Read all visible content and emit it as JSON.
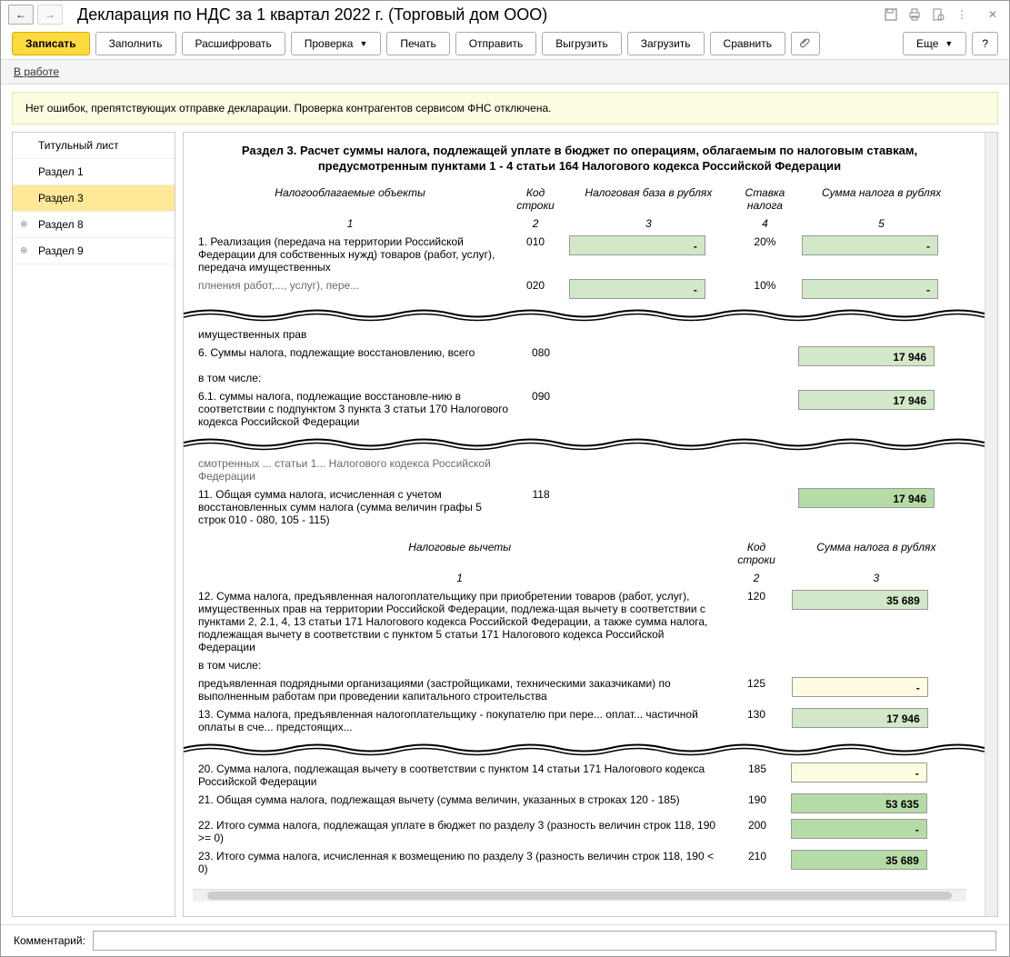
{
  "titlebar": {
    "title": "Декларация по НДС за 1 квартал 2022 г. (Торговый дом ООО)"
  },
  "toolbar": {
    "save": "Записать",
    "fill": "Заполнить",
    "decode": "Расшифровать",
    "check": "Проверка",
    "print": "Печать",
    "send": "Отправить",
    "upload": "Выгрузить",
    "load": "Загрузить",
    "compare": "Сравнить",
    "more": "Еще",
    "help": "?"
  },
  "status": {
    "label": "В работе"
  },
  "info": {
    "text": "Нет ошибок, препятствующих отправке декларации. Проверка контрагентов сервисом ФНС отключена."
  },
  "sidebar": {
    "items": [
      {
        "label": "Титульный лист"
      },
      {
        "label": "Раздел 1"
      },
      {
        "label": "Раздел 3"
      },
      {
        "label": "Раздел 8"
      },
      {
        "label": "Раздел 9"
      }
    ]
  },
  "section3": {
    "title": "Раздел 3. Расчет суммы налога, подлежащей уплате в бюджет по операциям, облагаемым по налоговым ставкам, предусмотренным пунктами 1 - 4 статьи 164 Налогового кодекса Российской Федерации",
    "header1": {
      "c1": "Налогооблагаемые объекты",
      "c2": "Код строки",
      "c3": "Налоговая база в рублях",
      "c4": "Ставка налога",
      "c5": "Сумма налога в рублях",
      "n1": "1",
      "n2": "2",
      "n3": "3",
      "n4": "4",
      "n5": "5"
    },
    "row1": {
      "desc": "1. Реализация (передача на территории Российской Федерации для собственных нужд) товаров (работ, услуг), передача имущественных",
      "code": "010",
      "base": "-",
      "rate": "20%",
      "tax": "-"
    },
    "row2fragment": {
      "desc": "плнения работ,..., услуг), пере...",
      "code": "020",
      "base": "-",
      "rate": "10%",
      "tax": "-"
    },
    "row5tail": "имущественных прав",
    "row6": {
      "desc": "6. Суммы налога, подлежащие восстановлению, всего",
      "code": "080",
      "tax": "17 946"
    },
    "including": "в том числе:",
    "row61": {
      "desc": "6.1. суммы налога, подлежащие восстановле-нию в соответствии с подпунктом 3 пункта 3 статьи 170 Налогового кодекса Российской Федерации",
      "code": "090",
      "tax": "17 946"
    },
    "row10tail": "смотренных ... статьи 1... Налогового кодекса Российской Федерации",
    "row11": {
      "desc": "11. Общая сумма налога, исчисленная с учетом восстановленных сумм налога (сумма величин графы 5 строк 010 - 080, 105 - 115)",
      "code": "118",
      "tax": "17 946"
    },
    "header2": {
      "c1": "Налоговые вычеты",
      "c2": "Код строки",
      "c3": "Сумма налога в рублях",
      "n1": "1",
      "n2": "2",
      "n3": "3"
    },
    "row12": {
      "desc": "12. Сумма налога, предъявленная налогоплательщику при приобретении товаров (работ, услуг), имущественных прав на территории Российской Федерации, подлежа-щая вычету в соответствии с пунктами 2, 2.1, 4, 13 статьи 171 Налогового кодекса Российской Федерации, а также сумма налога, подлежащая вычету в соответствии с пунктом 5 статьи 171 Налогового кодекса Российской Федерации",
      "code": "120",
      "tax": "35 689"
    },
    "row12a": {
      "desc": "предъявленная подрядными организациями (застройщиками, техническими заказчиками) по выполненным работам при проведении капитального строительства",
      "code": "125",
      "tax": "-"
    },
    "row13": {
      "desc": "13. Сумма налога, предъявленная налогоплательщику - покупателю при пере... оплат... частичной оплаты в сче... предстоящих...",
      "code": "130",
      "tax": "17 946"
    },
    "row20": {
      "desc": "20. Сумма налога, подлежащая вычету в соответствии с пунктом 14 статьи 171 Налогового кодекса Российской Федерации",
      "code": "185",
      "tax": "-"
    },
    "row21": {
      "desc": "21. Общая сумма налога, подлежащая вычету (сумма величин, указанных в строках 120 - 185)",
      "code": "190",
      "tax": "53 635"
    },
    "row22": {
      "desc": "22. Итого сумма налога, подлежащая уплате в бюджет по разделу 3 (разность величин строк 118, 190 >= 0)",
      "code": "200",
      "tax": "-"
    },
    "row23": {
      "desc": "23. Итого сумма налога, исчисленная к возмещению по разделу 3 (разность величин строк 118, 190 < 0)",
      "code": "210",
      "tax": "35 689"
    }
  },
  "footer": {
    "comment_label": "Комментарий:",
    "comment_value": ""
  }
}
